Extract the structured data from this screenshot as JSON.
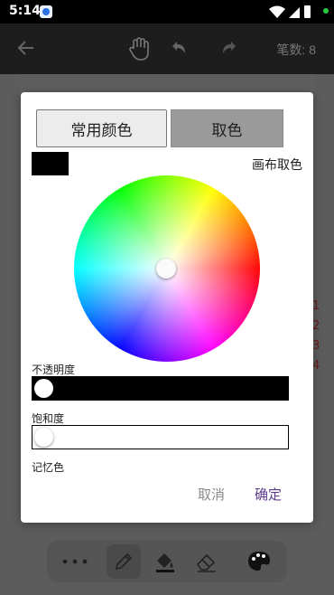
{
  "status_bar": {
    "time": "5:14"
  },
  "toolbar": {
    "stroke_count": "笔数: 8"
  },
  "side_numbers": [
    "1",
    "2",
    "3",
    "4"
  ],
  "dialog": {
    "tabs": {
      "common_colors": "常用颜色",
      "pick_color": "取色"
    },
    "canvas_pick_label": "画布取色",
    "current_color": "#000000",
    "opacity_label": "不透明度",
    "saturation_label": "饱和度",
    "memory_label": "记忆色",
    "cancel_label": "取消",
    "ok_label": "确定"
  },
  "colors": {
    "accent": "#5b3a8c",
    "selected": "#000000"
  },
  "icons": [
    "back-arrow-icon",
    "hand-icon",
    "undo-icon",
    "redo-icon",
    "more-icon",
    "pencil-icon",
    "fill-bucket-icon",
    "eraser-icon",
    "palette-icon"
  ]
}
